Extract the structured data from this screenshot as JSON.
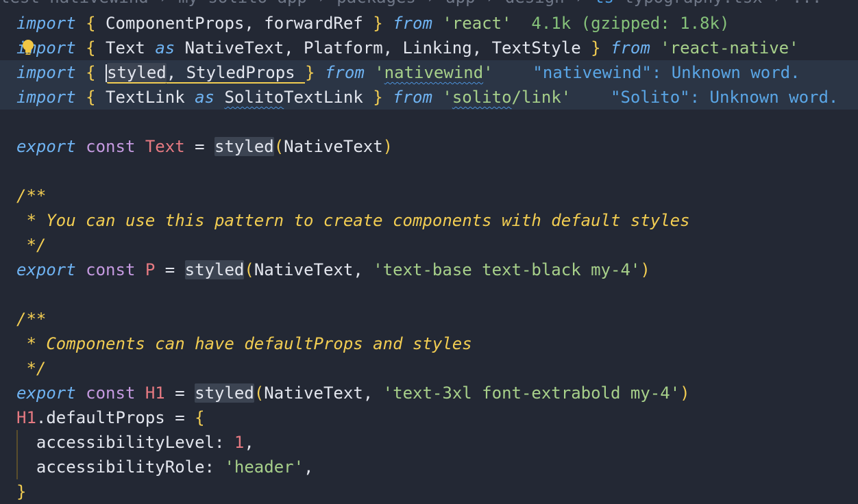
{
  "breadcrumb": {
    "text_before": "test-nativewind › my-solito-app › packages › app › design › ",
    "ts_icon": "ts",
    "file": "typography.tsx",
    "text_after": " › ..."
  },
  "colors": {
    "background": "#232834",
    "keyword_italic": "#6fb3f2",
    "keyword": "#c59ae0",
    "string": "#a7d08a",
    "bracket": "#f2cd52",
    "comment": "#f2cd52",
    "variable": "#e67a82",
    "hint": "#86c27a",
    "diagnostic": "#5aa6e6"
  },
  "code": {
    "l1": {
      "import": "import",
      "open": "{",
      "names": " ComponentProps, forwardRef ",
      "close": "}",
      "from": "from",
      "module": "'react'",
      "size_hint": "4.1k (gzipped: 1.8k)"
    },
    "l2": {
      "import": "import",
      "open": "{",
      "n1": " Text ",
      "as": "as",
      "n2": " NativeText, Platform, Linking, TextStyle ",
      "close": "}",
      "from": "from",
      "module": "'react-native'",
      "bulb_icon": "lightbulb-icon"
    },
    "l3": {
      "import": "import",
      "open": "{",
      "names_a": "styled",
      "names_b": ", StyledProps ",
      "close": "}",
      "from": "from",
      "q1": "'",
      "module": "nativewind",
      "q2": "'",
      "diagnostic": "\"nativewind\": Unknown word."
    },
    "l4": {
      "import": "import",
      "open": "{",
      "n1": " TextLink ",
      "as": "as",
      "n2a": "Solito",
      "n2b": "TextLink ",
      "close": "}",
      "from": "from",
      "q1": "'",
      "module_a": "solito",
      "module_b": "/link",
      "q2": "'",
      "diagnostic": "\"Solito\": Unknown word."
    },
    "l6": {
      "export": "export",
      "const": "const",
      "name": "Text",
      "eq": " = ",
      "fn": "styled",
      "open": "(",
      "arg": "NativeText",
      "close": ")"
    },
    "l8": "/**",
    "l9": " * You can use this pattern to create components with default styles",
    "l10": " */",
    "l11": {
      "export": "export",
      "const": "const",
      "name": "P",
      "eq": " = ",
      "fn": "styled",
      "open": "(",
      "arg": "NativeText, ",
      "str": "'text-base text-black my-4'",
      "close": ")"
    },
    "l13": "/**",
    "l14": " * Components can have defaultProps and styles",
    "l15": " */",
    "l16": {
      "export": "export",
      "const": "const",
      "name": "H1",
      "eq": " = ",
      "fn": "styled",
      "open": "(",
      "arg": "NativeText, ",
      "str": "'text-3xl font-extrabold my-4'",
      "close": ")"
    },
    "l17": {
      "name": "H1",
      "rest": ".defaultProps = ",
      "open": "{"
    },
    "l18": {
      "key": "accessibilityLevel",
      "colon": ": ",
      "value": "1",
      "comma": ","
    },
    "l19": {
      "key": "accessibilityRole",
      "colon": ": ",
      "value": "'header'",
      "comma": ","
    },
    "l20": "}"
  }
}
